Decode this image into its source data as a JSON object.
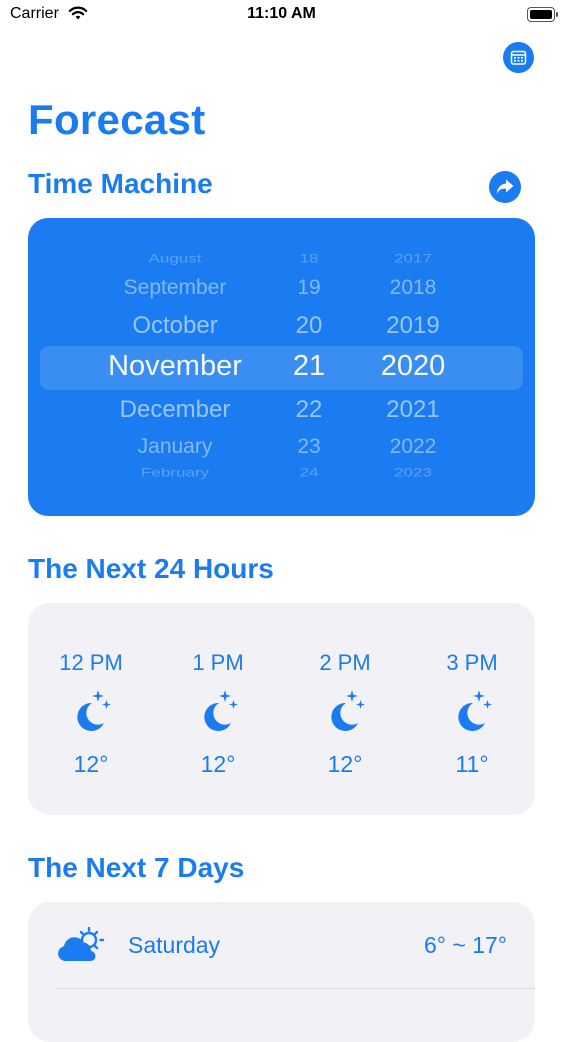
{
  "status_bar": {
    "carrier": "Carrier",
    "time": "11:10 AM"
  },
  "header": {
    "title": "Forecast"
  },
  "time_machine": {
    "title": "Time Machine",
    "picker": {
      "months": [
        "August",
        "September",
        "October",
        "November",
        "December",
        "January",
        "February"
      ],
      "days": [
        "18",
        "19",
        "20",
        "21",
        "22",
        "23",
        "24"
      ],
      "years": [
        "2017",
        "2018",
        "2019",
        "2020",
        "2021",
        "2022",
        "2023"
      ],
      "selected": {
        "month": "November",
        "day": "21",
        "year": "2020"
      }
    }
  },
  "next_24_hours": {
    "title": "The Next 24 Hours",
    "hours": [
      {
        "time": "12 PM",
        "icon": "moon-stars-icon",
        "temp": "12°"
      },
      {
        "time": "1 PM",
        "icon": "moon-stars-icon",
        "temp": "12°"
      },
      {
        "time": "2 PM",
        "icon": "moon-stars-icon",
        "temp": "12°"
      },
      {
        "time": "3 PM",
        "icon": "moon-stars-icon",
        "temp": "11°"
      }
    ]
  },
  "next_7_days": {
    "title": "The Next 7 Days",
    "days": [
      {
        "day": "Saturday",
        "icon": "cloud-sun-icon",
        "range": "6° ~ 17°"
      }
    ]
  },
  "colors": {
    "accent": "#1a7cf0",
    "card_background": "#f1f1f6"
  }
}
